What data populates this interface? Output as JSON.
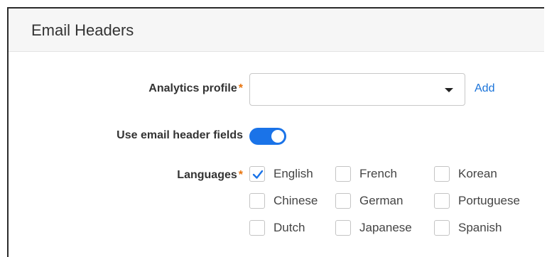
{
  "panel": {
    "title": "Email Headers"
  },
  "analytics_profile": {
    "label": "Analytics profile",
    "required_mark": "*",
    "value": "",
    "add_label": "Add"
  },
  "email_header_fields": {
    "label": "Use email header fields",
    "enabled": true
  },
  "languages": {
    "label": "Languages",
    "required_mark": "*",
    "options": [
      {
        "label": "English",
        "checked": true
      },
      {
        "label": "French",
        "checked": false
      },
      {
        "label": "Korean",
        "checked": false
      },
      {
        "label": "Chinese",
        "checked": false
      },
      {
        "label": "German",
        "checked": false
      },
      {
        "label": "Portuguese",
        "checked": false
      },
      {
        "label": "Dutch",
        "checked": false
      },
      {
        "label": "Japanese",
        "checked": false
      },
      {
        "label": "Spanish",
        "checked": false
      }
    ]
  },
  "colors": {
    "accent": "#1a73e8",
    "required": "#e8730c",
    "link": "#1a73d9"
  }
}
